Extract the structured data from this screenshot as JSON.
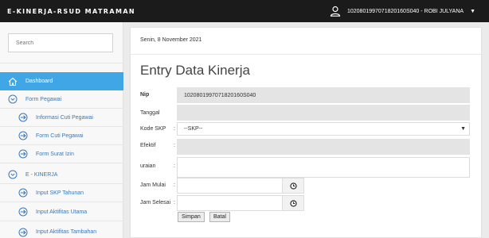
{
  "header": {
    "brand": "E-KINERJA-RSUD MATRAMAN",
    "user": "1020801997071820160S040 - ROBI JULYANA"
  },
  "sidebar": {
    "search_placeholder": "Search",
    "items": [
      {
        "label": "Dashboard",
        "icon": "home-icon"
      },
      {
        "label": "Form Pegawai",
        "icon": "chevron-circle-icon"
      },
      {
        "label": "Informasi Cuti Pegawai",
        "icon": "arrow-circle-icon"
      },
      {
        "label": "Form Cuti Pegawai",
        "icon": "arrow-circle-icon"
      },
      {
        "label": "Form Surat Izin",
        "icon": "arrow-circle-icon"
      },
      {
        "label": "E - KINERJA",
        "icon": "chevron-circle-icon"
      },
      {
        "label": "Input SKP Tahunan",
        "icon": "arrow-circle-icon"
      },
      {
        "label": "Input Aktifitas Utama",
        "icon": "arrow-circle-icon"
      },
      {
        "label": "Input Aktifitas Tambahan",
        "icon": "arrow-circle-icon"
      }
    ]
  },
  "main": {
    "date": "Senin, 8 November 2021",
    "title": "Entry Data Kinerja",
    "form": {
      "nip_label": "Nip",
      "nip_value": "1020801997071820160S040",
      "tanggal_label": "Tanggal",
      "kode_skp_label": "Kode SKP",
      "kode_skp_value": "--SKP--",
      "efektif_label": "Efektif",
      "uraian_label": "uraian",
      "jam_mulai_label": "Jam Mulai",
      "jam_selesai_label": "Jam Selesai",
      "colon": ":",
      "save_label": "Simpan",
      "cancel_label": "Batal"
    }
  }
}
